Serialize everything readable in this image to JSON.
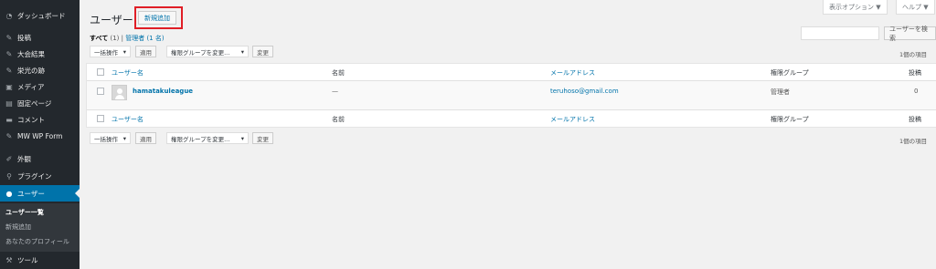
{
  "sidebar": {
    "items": [
      {
        "label": "ダッシュボード",
        "icon": "dashboard-icon",
        "glyph": "◔"
      },
      {
        "label": "投稿",
        "icon": "pin-icon",
        "glyph": "✎"
      },
      {
        "label": "大会結果",
        "icon": "pin-icon",
        "glyph": "✎"
      },
      {
        "label": "栄光の跡",
        "icon": "pin-icon",
        "glyph": "✎"
      },
      {
        "label": "メディア",
        "icon": "media-icon",
        "glyph": "▣"
      },
      {
        "label": "固定ページ",
        "icon": "page-icon",
        "glyph": "▤"
      },
      {
        "label": "コメント",
        "icon": "comment-icon",
        "glyph": "▬"
      },
      {
        "label": "MW WP Form",
        "icon": "pin-icon",
        "glyph": "✎"
      },
      {
        "label": "外観",
        "icon": "appearance-icon",
        "glyph": "✐"
      },
      {
        "label": "プラグイン",
        "icon": "plugin-icon",
        "glyph": "⚲"
      },
      {
        "label": "ユーザー",
        "icon": "user-icon",
        "glyph": "●"
      },
      {
        "label": "ツール",
        "icon": "tool-icon",
        "glyph": "⚒"
      }
    ],
    "submenu": [
      {
        "label": "ユーザー一覧"
      },
      {
        "label": "新規追加"
      },
      {
        "label": "あなたのプロフィール"
      }
    ]
  },
  "header": {
    "title": "ユーザー",
    "add_new": "新規追加",
    "screen_options": "表示オプション ▼",
    "help": "ヘルプ ▼"
  },
  "filters": {
    "all_label": "すべて",
    "all_count": "(1)",
    "separator": "|",
    "admin_label": "管理者",
    "admin_count": "(1 名)"
  },
  "search": {
    "button": "ユーザーを検索"
  },
  "actions": {
    "bulk": "一括操作",
    "apply": "適用",
    "role_change": "権限グループを変更...",
    "change": "変更",
    "item_count": "1個の項目"
  },
  "table": {
    "columns": [
      "ユーザー名",
      "名前",
      "メールアドレス",
      "権限グループ",
      "投稿"
    ],
    "rows": [
      {
        "username": "hamatakuleague",
        "name": "—",
        "email": "teruhoso@gmail.com",
        "role": "管理者",
        "posts": "0"
      }
    ]
  }
}
